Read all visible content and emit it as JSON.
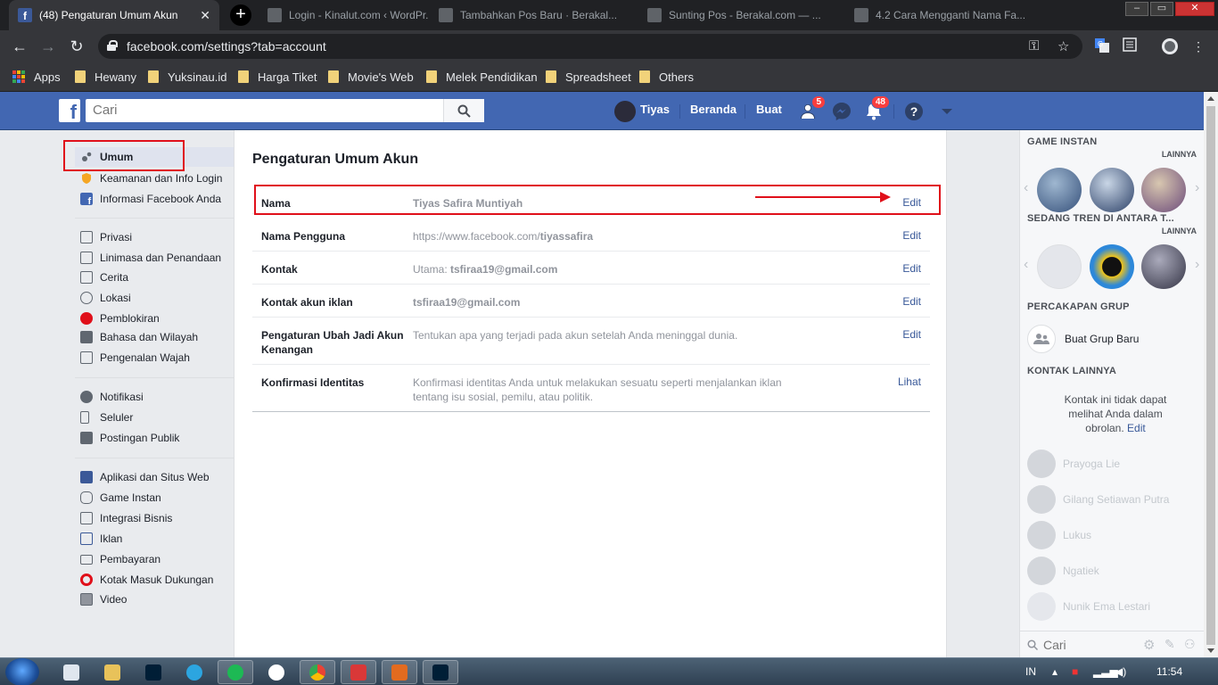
{
  "browser": {
    "active_tab_title": "(48) Pengaturan Umum Akun",
    "background_tabs": [
      "Login - Kinalut.com ‹ WordPr...",
      "Tambahkan Pos Baru · Berakal...",
      "Sunting Pos - Berakal.com — ...",
      "4.2 Cara Mengganti Nama Fa..."
    ],
    "url": "facebook.com/settings?tab=account",
    "bookmarks": [
      "Apps",
      "Hewany",
      "Yuksinau.id",
      "Harga Tiket",
      "Movie's Web",
      "Melek Pendidikan",
      "Spreadsheet",
      "Others"
    ]
  },
  "fb": {
    "search_placeholder": "Cari",
    "user_name": "Tiyas",
    "nav_home": "Beranda",
    "nav_create": "Buat",
    "friend_badge": "5",
    "notif_badge": "48"
  },
  "leftnav": {
    "groups": [
      [
        {
          "label": "Umum",
          "icon": "gears-icon",
          "active": true
        },
        {
          "label": "Keamanan dan Info Login",
          "icon": "shield-icon"
        },
        {
          "label": "Informasi Facebook Anda",
          "icon": "facebook-icon"
        }
      ],
      [
        {
          "label": "Privasi",
          "icon": "lock-icon"
        },
        {
          "label": "Linimasa dan Penandaan",
          "icon": "timeline-icon"
        },
        {
          "label": "Cerita",
          "icon": "book-icon"
        },
        {
          "label": "Lokasi",
          "icon": "location-icon"
        },
        {
          "label": "Pemblokiran",
          "icon": "block-icon"
        },
        {
          "label": "Bahasa dan Wilayah",
          "icon": "language-icon"
        },
        {
          "label": "Pengenalan Wajah",
          "icon": "face-icon"
        }
      ],
      [
        {
          "label": "Notifikasi",
          "icon": "globe-icon"
        },
        {
          "label": "Seluler",
          "icon": "mobile-icon"
        },
        {
          "label": "Postingan Publik",
          "icon": "rss-icon"
        }
      ],
      [
        {
          "label": "Aplikasi dan Situs Web",
          "icon": "apps-icon"
        },
        {
          "label": "Game Instan",
          "icon": "gamepad-icon"
        },
        {
          "label": "Integrasi Bisnis",
          "icon": "business-icon"
        },
        {
          "label": "Iklan",
          "icon": "ads-icon"
        },
        {
          "label": "Pembayaran",
          "icon": "card-icon"
        },
        {
          "label": "Kotak Masuk Dukungan",
          "icon": "lifebuoy-icon"
        },
        {
          "label": "Video",
          "icon": "film-icon"
        }
      ]
    ]
  },
  "settings": {
    "title": "Pengaturan Umum Akun",
    "rows": [
      {
        "label": "Nama",
        "value": "Tiyas Safira Muntiyah",
        "action": "Edit"
      },
      {
        "label": "Nama Pengguna",
        "value_prefix": "https://www.facebook.com/",
        "value": "tiyassafira",
        "action": "Edit"
      },
      {
        "label": "Kontak",
        "value_prefix": "Utama: ",
        "value": "tsfiraa19@gmail.com",
        "action": "Edit"
      },
      {
        "label": "Kontak akun iklan",
        "value": "tsfiraa19@gmail.com",
        "action": "Edit"
      },
      {
        "label": "Pengaturan Ubah Jadi Akun Kenangan",
        "value": "Tentukan apa yang terjadi pada akun setelah Anda meninggal dunia.",
        "action": "Edit"
      },
      {
        "label": "Konfirmasi Identitas",
        "value": "Konfirmasi identitas Anda untuk melakukan sesuatu seperti menjalankan iklan tentang isu sosial, pemilu, atau politik.",
        "action": "Lihat"
      }
    ]
  },
  "sidebar": {
    "games_heading": "GAME INSTAN",
    "more": "LAINNYA",
    "trending_heading": "SEDANG TREN DI ANTARA T...",
    "group_heading": "PERCAKAPAN GRUP",
    "new_group": "Buat Grup Baru",
    "contacts_heading": "KONTAK LAINNYA",
    "contacts_note": "Kontak ini tidak dapat melihat Anda dalam obrolan.",
    "contacts_note_link": "Edit",
    "contacts": [
      "Prayoga Lie",
      "Gilang Setiawan Putra",
      "Lukus",
      "Ngatiek",
      "Nunik Ema Lestari"
    ],
    "search_placeholder": "Cari"
  },
  "taskbar": {
    "lang": "IN",
    "time": "11:54"
  },
  "colors": {
    "fb_blue": "#4267b2",
    "link": "#385898",
    "highlight": "#e0101a"
  }
}
